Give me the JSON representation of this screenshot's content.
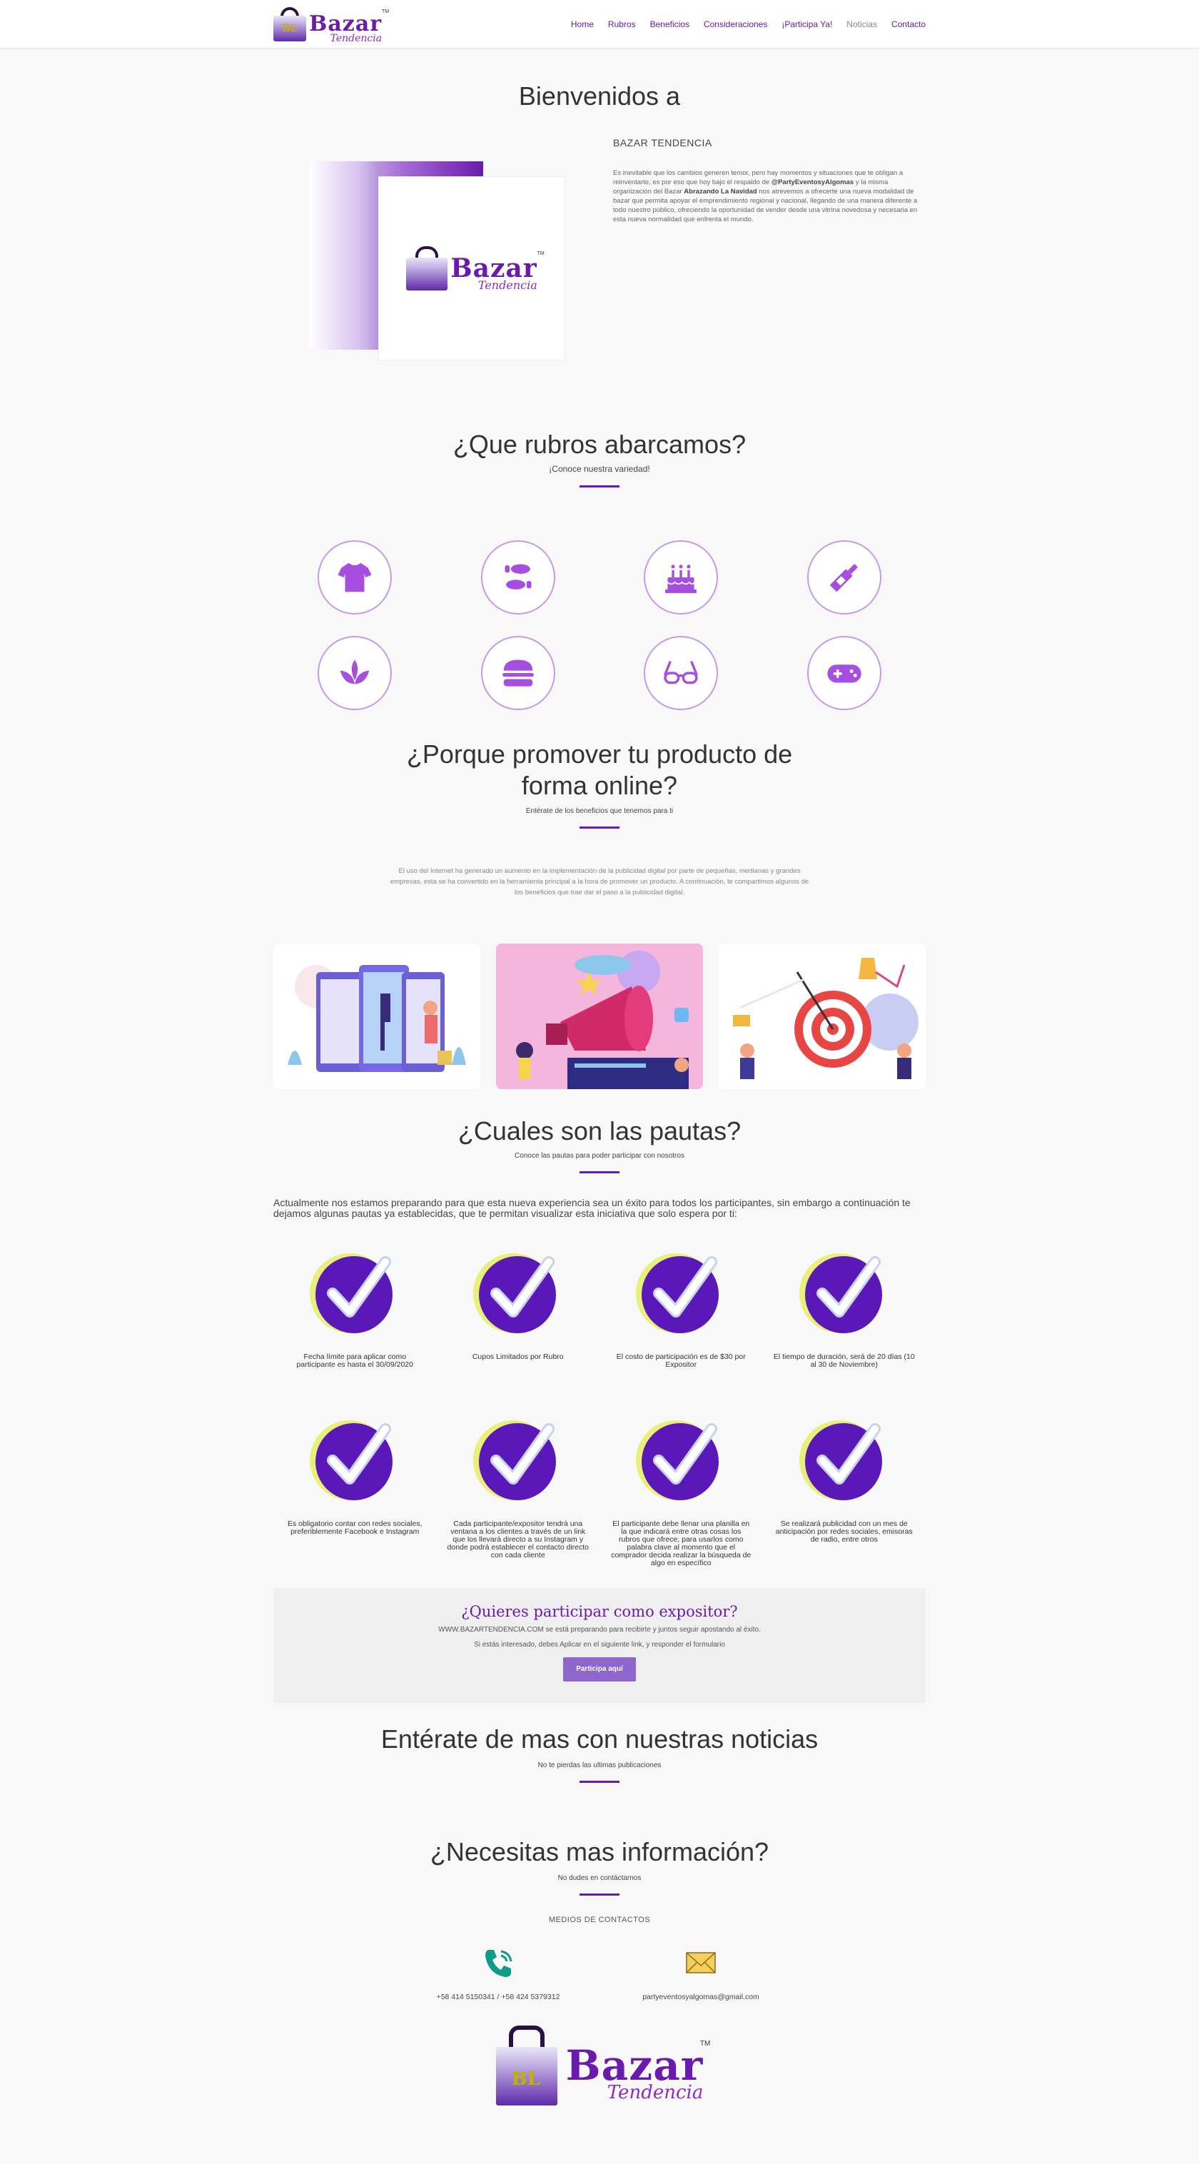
{
  "header": {
    "logo": {
      "brand": "Bazar",
      "tagline": "Tendencia",
      "tm": "TM",
      "bag_letters": "BL"
    },
    "nav": [
      {
        "label": "Home"
      },
      {
        "label": "Rubros"
      },
      {
        "label": "Beneficios"
      },
      {
        "label": "Consideraciones"
      },
      {
        "label": "¡Participa Ya!"
      },
      {
        "label": "Noticias"
      },
      {
        "label": "Contacto"
      }
    ]
  },
  "welcome": {
    "title": "Bienvenidos a",
    "heading": "BAZAR TENDENCIA",
    "text_1": "Es inevitable que los cambios generen temor, pero hay momentos y situaciones que te obligan a reinventarte, es por eso que hoy bajo el respaldo de ",
    "handle": "@PartyEventosyAlgomas",
    "text_2": " y la misma organización del Bazar ",
    "event": "Abrazando La Navidad",
    "text_3": " nos atrevemos a ofrecerte una nueva modalidad de bazar que permita apoyar el emprendimiento regional y nacional, llegando de una manera diferente a todo nuestro público, ofreciendo la oportunidad de vender desde una vitrina novedosa y necesaria en esta nueva normalidad que enfrenta el mundo."
  },
  "rubros": {
    "title": "¿Que rubros abarcamos?",
    "subtitle": "¡Conoce nuestra variedad!",
    "icons": [
      "tshirt-icon",
      "shoe-prints-icon",
      "birthday-cake-icon",
      "wine-bottle-icon",
      "spa-icon",
      "hamburger-icon",
      "glasses-icon",
      "gamepad-icon"
    ]
  },
  "beneficios": {
    "title_line1": "¿Porque promover tu producto de",
    "title_line2": "forma online?",
    "subtitle": "Entérate de los beneficios que tenemos para ti",
    "text": "El uso del Internet ha generado un aumento en la implementación de la publicidad digital por parte de pequeñas, medianas y grandes empresas, esta se ha convertido en la herramienta principal a la hora de promover un producto. A continuación, te compartimos algunos de los beneficios que trae  dar el paso a la publicidad digital."
  },
  "pautas": {
    "title": "¿Cuales son las pautas?",
    "subtitle": "Conoce las pautas para poder participar con nosotros",
    "intro": "Actualmente nos estamos preparando para que esta nueva experiencia sea un éxito para todos los participantes, sin embargo a continuación te dejamos algunas pautas ya establecidas, que te permitan visualizar esta iniciativa que solo espera por ti:",
    "items": [
      "Fecha límite para aplicar como participante es hasta el 30/09/2020",
      "Cupos Limitados por Rubro",
      "El costo de participación es de $30 por Expositor",
      "El tiempo de duración, será de 20 días (10 al 30 de Noviembre)",
      "Es obligatorio contar con redes sociales, preferiblemente Facebook e Instagram",
      "Cada participante/expositor tendrá una ventana a los clientes a través de un link que los llevará directo a su Instagram y donde podrá establecer el contacto directo con cada cliente",
      "El participante debe llenar una planilla en la que indicará entre otras cosas los rubros que ofrece, para usarlos como palabra clave al momento que el comprador decida realizar la búsqueda de algo en específico",
      "Se realizará publicidad con un mes de anticipación por redes sociales, emisoras de radio, entre otros"
    ]
  },
  "cta": {
    "title": "¿Quieres participar como expositor?",
    "line1": "WWW.BAZARTENDENCIA.COM se está preparando para recibirte y juntos seguir apostando al éxito.",
    "line2": "Si estás interesado, debes Aplicar en el siguiente link, y responder el formulario",
    "button": "Participa aquí"
  },
  "noticias": {
    "title": "Entérate de mas con nuestras noticias",
    "subtitle": "No te pierdas las ultimas publicaciones"
  },
  "contacto": {
    "title": "¿Necesitas mas información?",
    "subtitle": "No dudes en contáctarnos",
    "heading": "MEDIOS DE CONTACTOS",
    "phone": "+58 414 5150341 / +58 424 5379312",
    "email": "partyeventosyalgomas@gmail.com"
  },
  "colors": {
    "accent": "#6a1bab",
    "check_circle": "#5a18b8",
    "check_ring": "#e8f07a",
    "button": "#8e66cc"
  }
}
